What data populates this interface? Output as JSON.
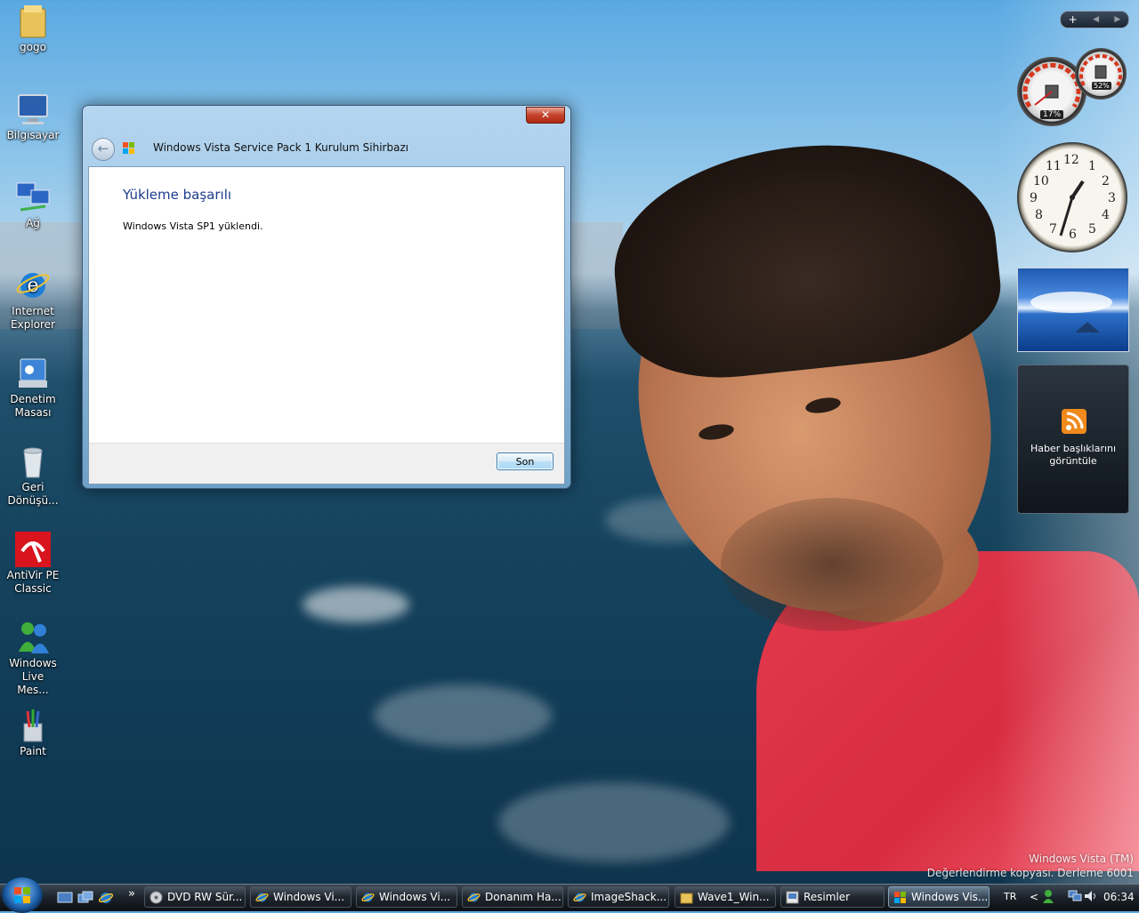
{
  "desktop": {
    "icons": [
      {
        "label": "gogo"
      },
      {
        "label": "Bilgisayar"
      },
      {
        "label": "Ağ"
      },
      {
        "label": "Internet Explorer"
      },
      {
        "label": "Denetim Masası"
      },
      {
        "label": "Geri Dönüşü..."
      },
      {
        "label": "AntiVir PE Classic"
      },
      {
        "label": "Windows Live Mes..."
      },
      {
        "label": "Paint"
      }
    ]
  },
  "sidebar": {
    "controls": {
      "add": "+",
      "prev": "◀",
      "next": "▶"
    },
    "cpu_gauge": {
      "cpu": "17%",
      "memory": "52%"
    },
    "clock": {
      "numbers": [
        "12",
        "1",
        "2",
        "3",
        "4",
        "5",
        "6",
        "7",
        "8",
        "9",
        "10",
        "11"
      ]
    },
    "feeds": {
      "text": "Haber başlıklarını görüntüle"
    }
  },
  "dialog": {
    "title": "Windows Vista Service Pack 1 Kurulum Sihirbazı",
    "heading": "Yükleme başarılı",
    "message": "Windows Vista SP1 yüklendi.",
    "finish_button": "Son",
    "close_glyph": "✕",
    "back_glyph": "←"
  },
  "watermark": {
    "line1": "Windows Vista (TM)",
    "line2": "Değerlendirme kopyası. Derleme 6001"
  },
  "taskbar": {
    "overflow": "»",
    "tasks": [
      {
        "label": "DVD RW Sür..."
      },
      {
        "label": "Windows Vi..."
      },
      {
        "label": "Windows Vi..."
      },
      {
        "label": "Donanım Ha..."
      },
      {
        "label": "ImageShack..."
      },
      {
        "label": "Wave1_Win..."
      },
      {
        "label": "Resimler"
      },
      {
        "label": "Windows Vis..."
      }
    ],
    "tray": {
      "language": "TR",
      "chevron": "<",
      "time": "06:34"
    }
  }
}
